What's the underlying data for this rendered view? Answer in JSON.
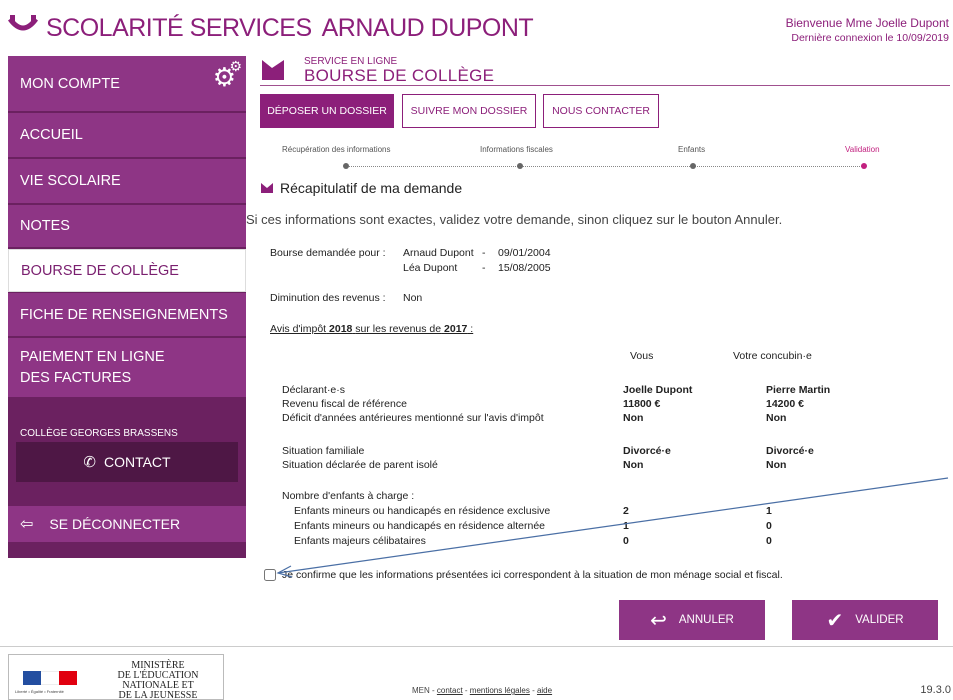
{
  "header": {
    "brand_title": "SCOLARITÉ SERVICES",
    "student_name": "ARNAUD DUPONT",
    "welcome": "Bienvenue Mme Joelle Dupont",
    "last_login": "Dernière connexion le 10/09/2019"
  },
  "sidebar": {
    "my_account": "MON COMPTE",
    "items": [
      {
        "label": "ACCUEIL"
      },
      {
        "label": "VIE SCOLAIRE"
      },
      {
        "label": "NOTES"
      },
      {
        "label": "BOURSE DE COLLÈGE"
      },
      {
        "label": "FICHE DE RENSEIGNEMENTS"
      },
      {
        "label": "PAIEMENT EN LIGNE DES FACTURES"
      }
    ],
    "college": "COLLÈGE GEORGES BRASSENS",
    "contact": "CONTACT",
    "logout": "SE DÉCONNECTER"
  },
  "service": {
    "kicker": "SERVICE EN LIGNE",
    "title": "BOURSE DE COLLÈGE"
  },
  "tabs": [
    {
      "label": "DÉPOSER UN DOSSIER"
    },
    {
      "label": "SUIVRE MON DOSSIER"
    },
    {
      "label": "NOUS CONTACTER"
    }
  ],
  "steps": [
    {
      "label": "Récupération des informations"
    },
    {
      "label": "Informations fiscales"
    },
    {
      "label": "Enfants"
    },
    {
      "label": "Validation"
    }
  ],
  "recap": {
    "title": "Récapitulatif de ma demande",
    "intro": "Si ces informations sont exactes, validez votre demande, sinon cliquez sur le bouton Annuler.",
    "bourse_label": "Bourse demandée pour :",
    "children": [
      {
        "name": "Arnaud Dupont",
        "sep": "-",
        "date": "09/01/2004"
      },
      {
        "name": "Léa Dupont",
        "sep": "-",
        "date": "15/08/2005"
      }
    ],
    "income_drop_label": "Diminution des revenus :",
    "income_drop_value": "Non",
    "avis_prefix": "Avis d'impôt",
    "avis_year": "2018",
    "avis_mid": "sur les revenus de",
    "avis_rev_year": "2017",
    "avis_suffix": " :",
    "col_you": "Vous",
    "col_partner": "Votre concubin·e",
    "rows": [
      {
        "label": "Déclarant·e·s",
        "you": "Joelle Dupont",
        "partner": "Pierre Martin"
      },
      {
        "label": "Revenu fiscal de référence",
        "you": "11800 €",
        "partner": "14200 €"
      },
      {
        "label": "Déficit d'années antérieures mentionné sur l'avis d'impôt",
        "you": "Non",
        "partner": "Non"
      },
      {
        "label": "Situation familiale",
        "you": "Divorcé·e",
        "partner": "Divorcé·e"
      },
      {
        "label": "Situation déclarée de parent isolé",
        "you": "Non",
        "partner": "Non"
      }
    ],
    "children_count_label": "Nombre d'enfants à charge :",
    "children_rows": [
      {
        "label": "Enfants mineurs ou handicapés en résidence exclusive",
        "you": "2",
        "partner": "1"
      },
      {
        "label": "Enfants mineurs ou handicapés en résidence alternée",
        "you": "1",
        "partner": "0"
      },
      {
        "label": "Enfants majeurs célibataires",
        "you": "0",
        "partner": "0"
      }
    ],
    "confirm": "Je confirme que les informations présentées ici correspondent à la situation de mon ménage social et fiscal."
  },
  "actions": {
    "cancel": "ANNULER",
    "validate": "VALIDER"
  },
  "footer": {
    "ministry_1": "MINISTÈRE",
    "ministry_2": "DE L'ÉDUCATION",
    "ministry_3": "NATIONALE ET",
    "ministry_4": "DE LA JEUNESSE",
    "motto": "Liberté • Égalité • Fraternité",
    "links_prefix": "MEN - ",
    "link_contact": "contact",
    "link_legal": "mentions légales",
    "link_help": "aide",
    "version": "19.3.0"
  },
  "colors": {
    "brand": "#8c1f7a",
    "sidebar_item": "#8e3585",
    "sidebar_bg": "#6b2160",
    "current_step": "#c2207f"
  }
}
